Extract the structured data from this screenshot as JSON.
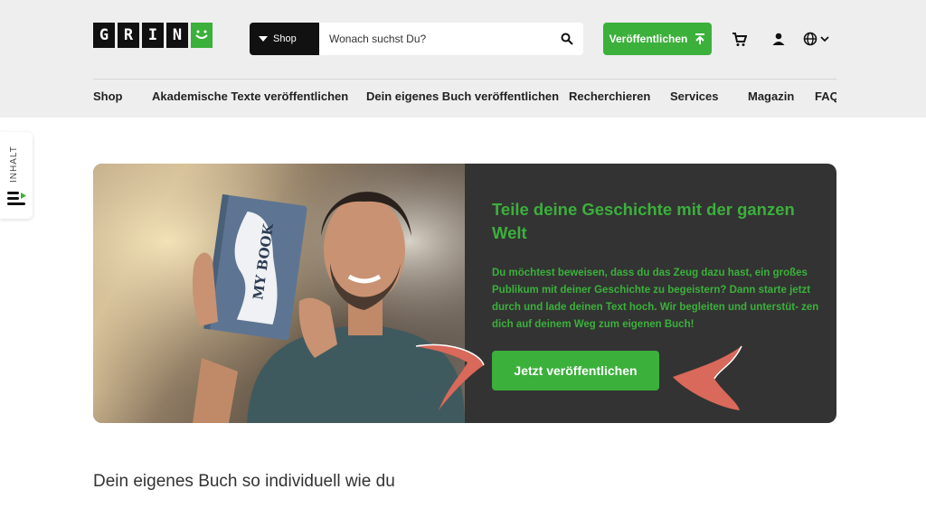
{
  "logo": {
    "letters": [
      "G",
      "R",
      "I",
      "N"
    ],
    "alt": "GRIN"
  },
  "search": {
    "category": "Shop",
    "placeholder": "Wonach suchst Du?"
  },
  "header": {
    "publish_label": "Veröffentlichen"
  },
  "icons": {
    "search": "search-icon",
    "cart": "cart-icon",
    "user": "user-icon",
    "language": "globe-icon"
  },
  "nav": {
    "items": [
      "Shop",
      "Akademische Texte veröffentlichen",
      "Dein eigenes Buch veröffentlichen",
      "Recherchieren",
      "Services",
      "Magazin",
      "FAQ"
    ]
  },
  "sidebar_tab": {
    "label": "INHALT"
  },
  "hero": {
    "book_text": "MY BOOK",
    "title": "Teile deine Geschichte mit der ganzen Welt",
    "text": "Du möchtest beweisen, dass du das Zeug dazu hast, ein großes Publikum mit deiner Geschichte zu begeistern? Dann starte jetzt durch und lade deinen Text hoch. Wir begleiten und unterstüt- zen dich auf deinem Weg zum eigenen Buch!",
    "cta_label": "Jetzt veröffentlichen"
  },
  "section": {
    "title": "Dein eigenes Buch so individuell wie du"
  },
  "colors": {
    "brand_green": "#3bb03b",
    "hero_bg": "#333333",
    "header_bg": "#eeeeee",
    "accent_coral": "#d9695a"
  }
}
